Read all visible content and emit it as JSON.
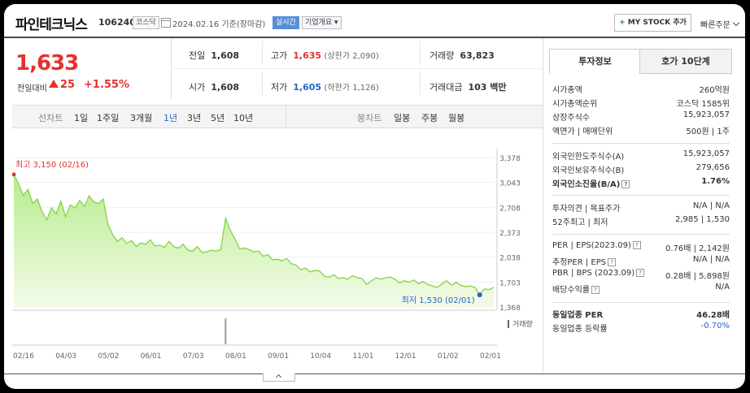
{
  "header": {
    "title": "파인테크닉스",
    "code": "106240",
    "market": "코스닥",
    "date": "2024.02.16  기준(장마감)",
    "realtime": "실시간",
    "corp": "기업개요",
    "mystock": "MY STOCK 추가",
    "quick_order": "빠른주문"
  },
  "price": {
    "current": "1,633",
    "change_label": "전일대비",
    "change": "25",
    "change_pct": "+1.55%"
  },
  "quotes": {
    "prev_label": "전일",
    "prev": "1,608",
    "high_label": "고가",
    "high": "1,635",
    "upper_limit": "(상한가 2,090)",
    "volume_label": "거래량",
    "volume": "63,823",
    "open_label": "시가",
    "open": "1,608",
    "low_label": "저가",
    "low": "1,605",
    "lower_limit": "(하한가 1,126)",
    "value_label": "거래대금",
    "value": "103 백만"
  },
  "period_bar": {
    "line_label": "선차트",
    "line_periods": [
      "1일",
      "1주일",
      "3개월",
      "1년",
      "3년",
      "5년",
      "10년"
    ],
    "active_period": "1년",
    "candle_label": "봉차트",
    "candle_periods": [
      "일봉",
      "주봉",
      "월봉"
    ]
  },
  "chart_data": {
    "type": "area",
    "x_tick_labels": [
      "02/16",
      "04/03",
      "05/02",
      "06/01",
      "07/03",
      "08/01",
      "09/01",
      "10/04",
      "11/01",
      "12/01",
      "01/02",
      "02/01"
    ],
    "y_tick_labels": [
      "3,378",
      "3,043",
      "2,708",
      "2,373",
      "2,038",
      "1,703",
      "1,368"
    ],
    "ylim": [
      1368,
      3378
    ],
    "high_annotation": "최고 3,150 (02/16)",
    "low_annotation": "최저 1,530 (02/01)",
    "volume_legend": "거래량",
    "series": [
      {
        "values": [
          3150,
          3020,
          2870,
          2950,
          2760,
          2820,
          2650,
          2540,
          2700,
          2620,
          2790,
          2580,
          2740,
          2700,
          2800,
          2720,
          2860,
          2780,
          2760,
          2820,
          2480,
          2340,
          2250,
          2300,
          2220,
          2260,
          2180,
          2230,
          2210,
          2270,
          2190,
          2200,
          2170,
          2250,
          2180,
          2160,
          2210,
          2130,
          2120,
          2180,
          2100,
          2110,
          2130,
          2120,
          2140,
          2560,
          2400,
          2280,
          2150,
          2160,
          2140,
          2110,
          2120,
          2050,
          2070,
          2000,
          2010,
          1990,
          2020,
          1950,
          1930,
          1870,
          1890,
          1840,
          1860,
          1850,
          1780,
          1770,
          1800,
          1750,
          1760,
          1740,
          1790,
          1760,
          1750,
          1670,
          1720,
          1760,
          1740,
          1760,
          1770,
          1740,
          1690,
          1720,
          1700,
          1730,
          1680,
          1710,
          1670,
          1650,
          1630,
          1680,
          1720,
          1660,
          1700,
          1660,
          1640,
          1650,
          1630,
          1530,
          1610,
          1600,
          1633
        ]
      }
    ]
  },
  "info_tabs": [
    "투자정보",
    "호가 10단계"
  ],
  "info": {
    "cap_label": "시가총액",
    "cap": "260억원",
    "cap_rank_label": "시가총액순위",
    "cap_rank": "코스닥 1585위",
    "shares_label": "상장주식수",
    "shares": "15,923,057",
    "par_label": "액면가 | 매매단위",
    "par": "500원 | 1주",
    "foreign_limit_label": "외국인한도주식수(A)",
    "foreign_limit": "15,923,057",
    "foreign_hold_label": "외국인보유주식수(B)",
    "foreign_hold": "279,656",
    "foreign_ratio_label": "외국인소진율(B/A)",
    "foreign_ratio": "1.76%",
    "opinion_label": "투자의견 | 목표주가",
    "opinion": "N/A | N/A",
    "w52_label": "52주최고 | 최저",
    "w52": "2,985 | 1,530",
    "per_label": "PER | EPS(2023.09)",
    "per": "0.76배 | 2,142원",
    "est_per_label": "추정PER | EPS",
    "est_per": "N/A | N/A",
    "pbr_label": "PBR | BPS (2023.09)",
    "pbr": "0.28배 | 5,898원",
    "div_label": "배당수익률",
    "div": "N/A",
    "sector_per_label": "동일업종 PER",
    "sector_per": "46.28배",
    "sector_chg_label": "동일업종 등락률",
    "sector_chg": "-0.70%"
  }
}
